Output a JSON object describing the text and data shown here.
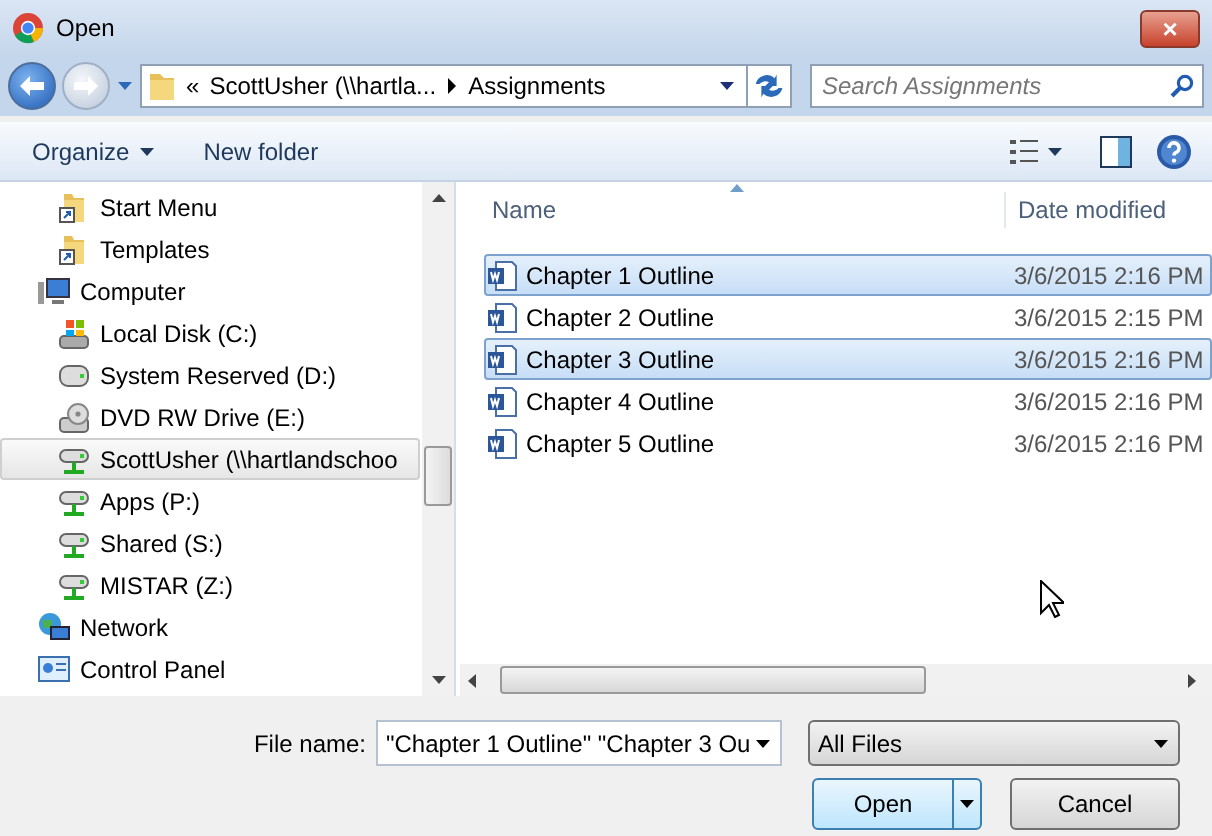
{
  "window": {
    "title": "Open",
    "close_label": "×"
  },
  "address": {
    "path": [
      "ScottUsher (\\\\hartla...",
      "Assignments"
    ],
    "overflow": "«"
  },
  "search": {
    "placeholder": "Search Assignments"
  },
  "toolbar": {
    "organize": "Organize",
    "new_folder": "New folder"
  },
  "tree": [
    {
      "children": [
        {
          "label": "Start Menu",
          "kind": "shortcut-folder",
          "selected": false
        },
        {
          "label": "Templates",
          "kind": "shortcut-folder",
          "selected": false
        }
      ]
    },
    {
      "label": "Computer",
      "kind": "computer",
      "selected": false,
      "children": [
        {
          "label": "Local Disk (C:)",
          "kind": "system-disk",
          "selected": false
        },
        {
          "label": "System Reserved (D:)",
          "kind": "drive",
          "selected": false
        },
        {
          "label": "DVD RW Drive (E:)",
          "kind": "dvd",
          "selected": false
        },
        {
          "label": "ScottUsher (\\\\hartlandschoo",
          "kind": "network-drive",
          "selected": true
        },
        {
          "label": "Apps (P:)",
          "kind": "network-drive",
          "selected": false
        },
        {
          "label": "Shared (S:)",
          "kind": "network-drive",
          "selected": false
        },
        {
          "label": "MISTAR (Z:)",
          "kind": "network-drive",
          "selected": false
        }
      ]
    },
    {
      "label": "Network",
      "kind": "network",
      "selected": false
    },
    {
      "label": "Control Panel",
      "kind": "control-panel",
      "selected": false
    }
  ],
  "files": {
    "columns": [
      "Name",
      "Date modified"
    ],
    "rows": [
      {
        "name": "Chapter 1 Outline",
        "date": "3/6/2015 2:16 PM",
        "selected": true
      },
      {
        "name": "Chapter 2 Outline",
        "date": "3/6/2015 2:15 PM",
        "selected": false
      },
      {
        "name": "Chapter 3 Outline",
        "date": "3/6/2015 2:16 PM",
        "selected": true
      },
      {
        "name": "Chapter 4 Outline",
        "date": "3/6/2015 2:16 PM",
        "selected": false
      },
      {
        "name": "Chapter 5 Outline",
        "date": "3/6/2015 2:16 PM",
        "selected": false
      }
    ]
  },
  "file_name": {
    "label": "File name:",
    "value": "\"Chapter 1 Outline\" \"Chapter 3 Ou"
  },
  "file_type": {
    "value": "All Files"
  },
  "buttons": {
    "open": "Open",
    "cancel": "Cancel"
  }
}
